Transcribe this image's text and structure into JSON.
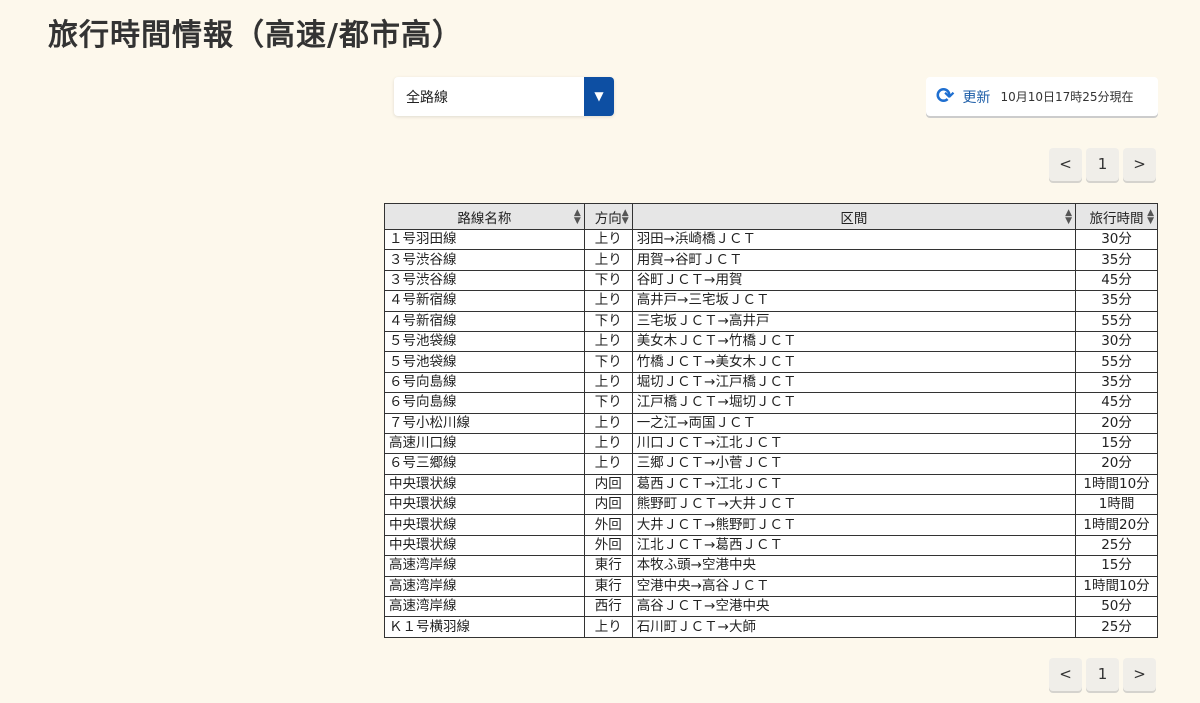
{
  "title": "旅行時間情報（高速/都市高）",
  "route_select": {
    "value": "全路線"
  },
  "refresh": {
    "label": "更新",
    "timestamp": "10月10日17時25分現在"
  },
  "pager": {
    "prev": "<",
    "page": "1",
    "next": ">"
  },
  "table": {
    "headers": [
      "路線名称",
      "方向",
      "区間",
      "旅行時間"
    ],
    "rows": [
      [
        "１号羽田線",
        "上り",
        "羽田→浜崎橋ＪＣＴ",
        "30分"
      ],
      [
        "３号渋谷線",
        "上り",
        "用賀→谷町ＪＣＴ",
        "35分"
      ],
      [
        "３号渋谷線",
        "下り",
        "谷町ＪＣＴ→用賀",
        "45分"
      ],
      [
        "４号新宿線",
        "上り",
        "高井戸→三宅坂ＪＣＴ",
        "35分"
      ],
      [
        "４号新宿線",
        "下り",
        "三宅坂ＪＣＴ→高井戸",
        "55分"
      ],
      [
        "５号池袋線",
        "上り",
        "美女木ＪＣＴ→竹橋ＪＣＴ",
        "30分"
      ],
      [
        "５号池袋線",
        "下り",
        "竹橋ＪＣＴ→美女木ＪＣＴ",
        "55分"
      ],
      [
        "６号向島線",
        "上り",
        "堀切ＪＣＴ→江戸橋ＪＣＴ",
        "35分"
      ],
      [
        "６号向島線",
        "下り",
        "江戸橋ＪＣＴ→堀切ＪＣＴ",
        "45分"
      ],
      [
        "７号小松川線",
        "上り",
        "一之江→両国ＪＣＴ",
        "20分"
      ],
      [
        "高速川口線",
        "上り",
        "川口ＪＣＴ→江北ＪＣＴ",
        "15分"
      ],
      [
        "６号三郷線",
        "上り",
        "三郷ＪＣＴ→小菅ＪＣＴ",
        "20分"
      ],
      [
        "中央環状線",
        "内回",
        "葛西ＪＣＴ→江北ＪＣＴ",
        "1時間10分"
      ],
      [
        "中央環状線",
        "内回",
        "熊野町ＪＣＴ→大井ＪＣＴ",
        "1時間"
      ],
      [
        "中央環状線",
        "外回",
        "大井ＪＣＴ→熊野町ＪＣＴ",
        "1時間20分"
      ],
      [
        "中央環状線",
        "外回",
        "江北ＪＣＴ→葛西ＪＣＴ",
        "25分"
      ],
      [
        "高速湾岸線",
        "東行",
        "本牧ふ頭→空港中央",
        "15分"
      ],
      [
        "高速湾岸線",
        "東行",
        "空港中央→高谷ＪＣＴ",
        "1時間10分"
      ],
      [
        "高速湾岸線",
        "西行",
        "高谷ＪＣＴ→空港中央",
        "50分"
      ],
      [
        "Ｋ１号横羽線",
        "上り",
        "石川町ＪＣＴ→大師",
        "25分"
      ]
    ]
  }
}
